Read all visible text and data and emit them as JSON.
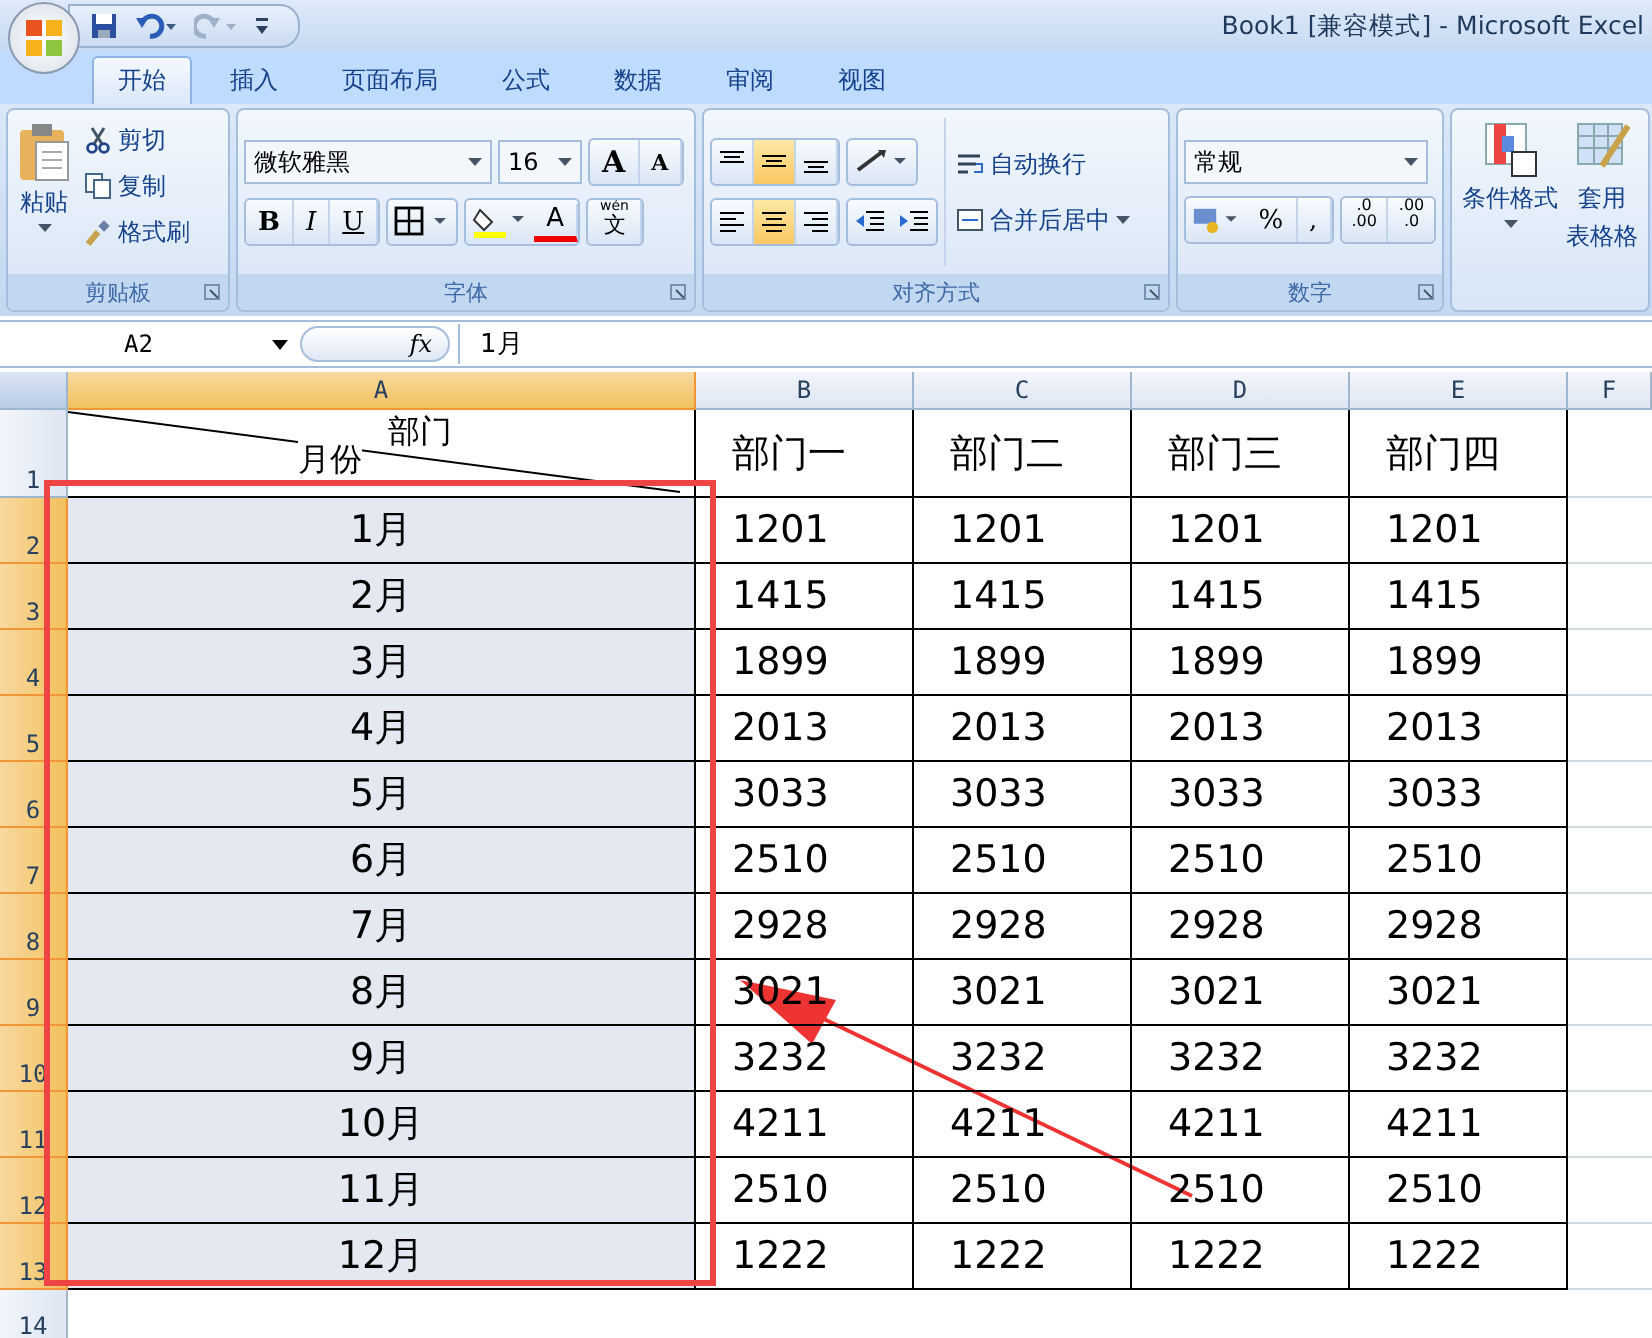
{
  "window": {
    "title": "Book1  [兼容模式] - Microsoft Excel"
  },
  "tabs": [
    {
      "label": "开始",
      "selected": true
    },
    {
      "label": "插入",
      "selected": false
    },
    {
      "label": "页面布局",
      "selected": false
    },
    {
      "label": "公式",
      "selected": false
    },
    {
      "label": "数据",
      "selected": false
    },
    {
      "label": "审阅",
      "selected": false
    },
    {
      "label": "视图",
      "selected": false
    }
  ],
  "ribbon": {
    "clipboard": {
      "label": "剪贴板",
      "paste": "粘贴",
      "cut": "剪切",
      "copy": "复制",
      "format_painter": "格式刷"
    },
    "font": {
      "label": "字体",
      "name": "微软雅黑",
      "size": "16",
      "grow": "A",
      "shrink": "A",
      "bold": "B",
      "italic": "I",
      "underline": "U",
      "font_color": "A",
      "phonetic_top": "wén",
      "phonetic_bottom": "文"
    },
    "alignment": {
      "label": "对齐方式",
      "wrap": "自动换行",
      "merge": "合并后居中",
      "vertical": [
        {
          "selected": false
        },
        {
          "selected": true
        },
        {
          "selected": false
        }
      ],
      "horizontal": [
        {
          "selected": false
        },
        {
          "selected": true
        },
        {
          "selected": false
        }
      ]
    },
    "number": {
      "label": "数字",
      "format": "常规",
      "percent": "%",
      "comma": ",",
      "more_decimal": [
        ".0",
        ".00"
      ],
      "less_decimal": [
        ".00",
        ".0"
      ]
    },
    "styles": {
      "conditional": "条件格式",
      "table_top": "套用",
      "table_bottom": "表格格"
    }
  },
  "formula_bar": {
    "name_box": "A2",
    "fx": "fx",
    "value": "1月"
  },
  "sheet": {
    "columns": [
      {
        "label": "A",
        "selected": true
      },
      {
        "label": "B",
        "selected": false
      },
      {
        "label": "C",
        "selected": false
      },
      {
        "label": "D",
        "selected": false
      },
      {
        "label": "E",
        "selected": false
      },
      {
        "label": "F",
        "selected": false
      }
    ],
    "header_row": {
      "number": "1",
      "corner_top": "部门",
      "corner_bottom": "月份",
      "cells": [
        "部门一",
        "部门二",
        "部门三",
        "部门四"
      ]
    },
    "rows": [
      {
        "number": "2",
        "selected": true,
        "cells": [
          "1月",
          "1201",
          "1201",
          "1201",
          "1201"
        ]
      },
      {
        "number": "3",
        "selected": true,
        "cells": [
          "2月",
          "1415",
          "1415",
          "1415",
          "1415"
        ]
      },
      {
        "number": "4",
        "selected": true,
        "cells": [
          "3月",
          "1899",
          "1899",
          "1899",
          "1899"
        ]
      },
      {
        "number": "5",
        "selected": true,
        "cells": [
          "4月",
          "2013",
          "2013",
          "2013",
          "2013"
        ]
      },
      {
        "number": "6",
        "selected": true,
        "cells": [
          "5月",
          "3033",
          "3033",
          "3033",
          "3033"
        ]
      },
      {
        "number": "7",
        "selected": true,
        "cells": [
          "6月",
          "2510",
          "2510",
          "2510",
          "2510"
        ]
      },
      {
        "number": "8",
        "selected": true,
        "cells": [
          "7月",
          "2928",
          "2928",
          "2928",
          "2928"
        ]
      },
      {
        "number": "9",
        "selected": true,
        "cells": [
          "8月",
          "3021",
          "3021",
          "3021",
          "3021"
        ]
      },
      {
        "number": "10",
        "selected": true,
        "cells": [
          "9月",
          "3232",
          "3232",
          "3232",
          "3232"
        ]
      },
      {
        "number": "11",
        "selected": true,
        "cells": [
          "10月",
          "4211",
          "4211",
          "4211",
          "4211"
        ]
      },
      {
        "number": "12",
        "selected": true,
        "cells": [
          "11月",
          "2510",
          "2510",
          "2510",
          "2510"
        ]
      },
      {
        "number": "13",
        "selected": true,
        "cells": [
          "12月",
          "1222",
          "1222",
          "1222",
          "1222"
        ]
      }
    ],
    "last_row": {
      "number": "14"
    }
  }
}
